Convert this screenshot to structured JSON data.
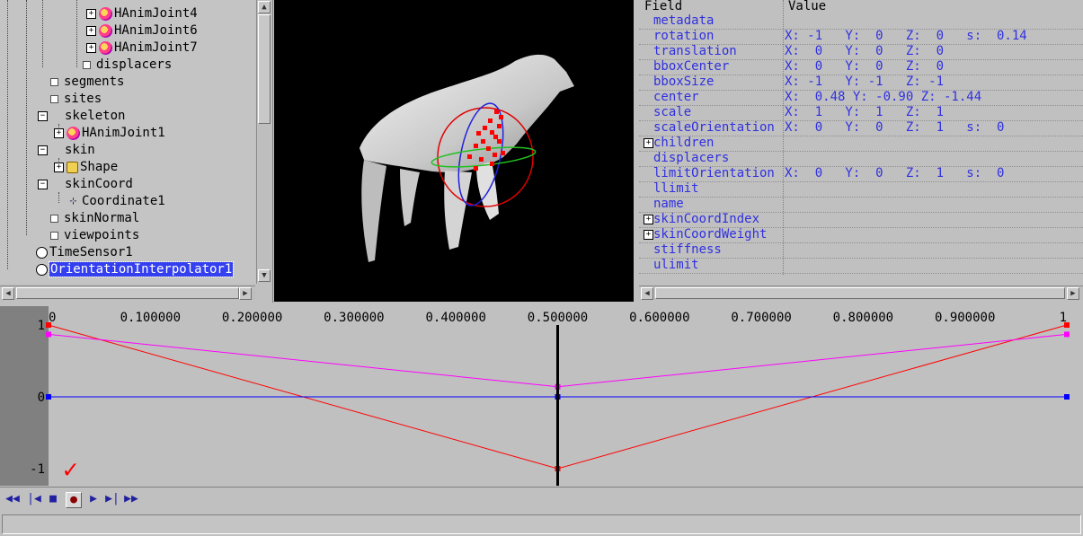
{
  "tree": {
    "items": [
      {
        "label": "HAnimJoint4",
        "icon": "joint-icon"
      },
      {
        "label": "HAnimJoint6",
        "icon": "joint-icon"
      },
      {
        "label": "HAnimJoint7",
        "icon": "joint-icon"
      },
      {
        "label": "displacers",
        "icon": "leaf-icon"
      },
      {
        "label": "segments",
        "icon": "leaf-icon"
      },
      {
        "label": "sites",
        "icon": "leaf-icon"
      },
      {
        "label": "skeleton",
        "icon": "expand-icon"
      },
      {
        "label": "HAnimJoint1",
        "icon": "joint-icon"
      },
      {
        "label": "skin",
        "icon": "expand-icon"
      },
      {
        "label": "Shape",
        "icon": "shape-icon"
      },
      {
        "label": "skinCoord",
        "icon": "expand-icon"
      },
      {
        "label": "Coordinate1",
        "icon": "coordinate-icon"
      },
      {
        "label": "skinNormal",
        "icon": "leaf-icon"
      },
      {
        "label": "viewpoints",
        "icon": "leaf-icon"
      },
      {
        "label": "TimeSensor1",
        "icon": "clock-icon"
      },
      {
        "label": "OrientationInterpolator1",
        "icon": "interpolator-icon"
      }
    ]
  },
  "fields": {
    "header_field": "Field",
    "header_value": "Value",
    "rows": [
      {
        "name": "metadata",
        "value": ""
      },
      {
        "name": "rotation",
        "value": "X: -1   Y:  0   Z:  0   s:  0.14"
      },
      {
        "name": "translation",
        "value": "X:  0   Y:  0   Z:  0"
      },
      {
        "name": "bboxCenter",
        "value": "X:  0   Y:  0   Z:  0"
      },
      {
        "name": "bboxSize",
        "value": "X: -1   Y: -1   Z: -1"
      },
      {
        "name": "center",
        "value": "X:  0.48 Y: -0.90 Z: -1.44"
      },
      {
        "name": "scale",
        "value": "X:  1   Y:  1   Z:  1"
      },
      {
        "name": "scaleOrientation",
        "value": "X:  0   Y:  0   Z:  1   s:  0"
      },
      {
        "name": "children",
        "value": "",
        "expandable": true
      },
      {
        "name": "displacers",
        "value": ""
      },
      {
        "name": "limitOrientation",
        "value": "X:  0   Y:  0   Z:  1   s:  0"
      },
      {
        "name": "llimit",
        "value": ""
      },
      {
        "name": "name",
        "value": ""
      },
      {
        "name": "skinCoordIndex",
        "value": "",
        "expandable": true
      },
      {
        "name": "skinCoordWeight",
        "value": "",
        "expandable": true
      },
      {
        "name": "stiffness",
        "value": ""
      },
      {
        "name": "ulimit",
        "value": ""
      }
    ]
  },
  "chart_data": {
    "type": "line",
    "x_ticks": [
      "0",
      "0.100000",
      "0.200000",
      "0.300000",
      "0.400000",
      "0.500000",
      "0.600000",
      "0.700000",
      "0.800000",
      "0.900000",
      "1"
    ],
    "y_ticks": [
      "1",
      "0",
      "-1"
    ],
    "ylim": [
      -1,
      1
    ],
    "xlim": [
      0,
      1
    ],
    "current_time": 0.5,
    "series": [
      {
        "color": "#ff0000",
        "x": [
          0,
          0.5,
          1
        ],
        "y": [
          1,
          -1,
          1
        ]
      },
      {
        "color": "#ff00ff",
        "x": [
          0,
          0.5,
          1
        ],
        "y": [
          0.87,
          0.14,
          0.87
        ]
      },
      {
        "color": "#0000ff",
        "x": [
          0,
          0.5,
          1
        ],
        "y": [
          0,
          0,
          0
        ]
      }
    ]
  },
  "toolbar": {
    "buttons": [
      {
        "name": "rewind-button",
        "glyph": "◀◀"
      },
      {
        "name": "step-back-button",
        "glyph": "|◀"
      },
      {
        "name": "stop-button",
        "glyph": "■"
      },
      {
        "name": "record-button",
        "glyph": "●"
      },
      {
        "name": "play-button",
        "glyph": "▶"
      },
      {
        "name": "step-forward-button",
        "glyph": "▶|"
      },
      {
        "name": "fast-forward-button",
        "glyph": "▶▶"
      }
    ]
  },
  "annotation": {
    "mark": "✓",
    "color": "#ff0000"
  }
}
